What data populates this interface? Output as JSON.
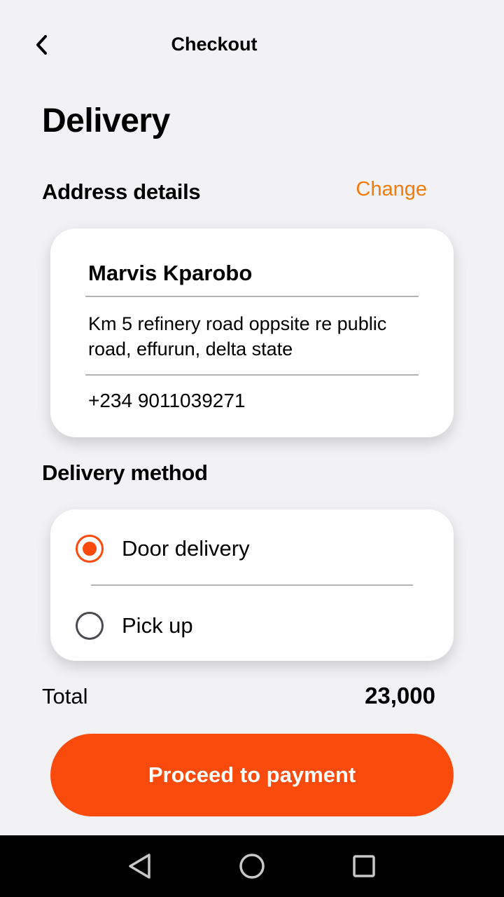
{
  "header": {
    "title": "Checkout",
    "back_icon": "chevron-left-icon"
  },
  "page_title": "Delivery",
  "address": {
    "section_title": "Address details",
    "change_label": "Change",
    "name": "Marvis Kparobo",
    "street": "Km 5 refinery road oppsite re public road, effurun, delta state",
    "phone": "+234 9011039271"
  },
  "delivery_method": {
    "section_title": "Delivery method",
    "options": [
      {
        "label": "Door delivery",
        "selected": true
      },
      {
        "label": "Pick up",
        "selected": false
      }
    ]
  },
  "total": {
    "label": "Total",
    "value": "23,000"
  },
  "proceed_label": "Proceed to payment",
  "colors": {
    "accent": "#fa4a0c",
    "link": "#f47b0a",
    "background": "#f2f2f4"
  },
  "system_nav": {
    "back_icon": "triangle-back-icon",
    "home_icon": "circle-home-icon",
    "recents_icon": "square-recents-icon"
  }
}
